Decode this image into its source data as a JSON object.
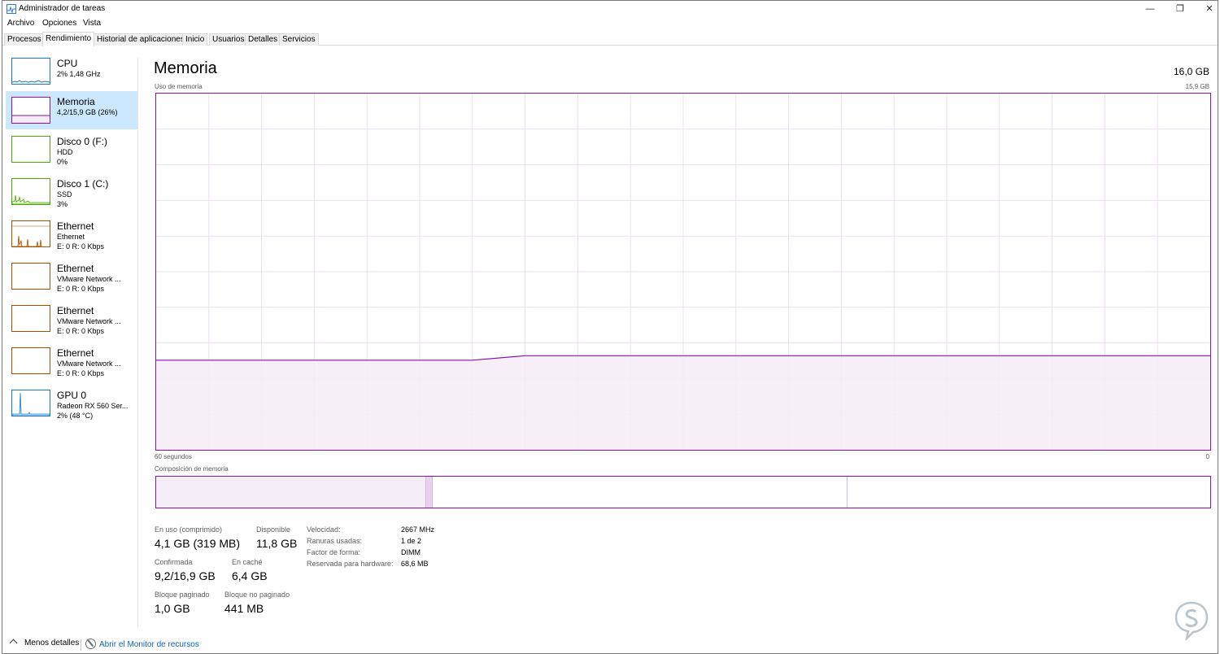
{
  "window": {
    "title": "Administrador de tareas",
    "minimize_glyph": "—",
    "maximize_glyph": "❐",
    "close_glyph": "✕"
  },
  "menu": [
    "Archivo",
    "Opciones",
    "Vista"
  ],
  "tabs": [
    {
      "label": "Procesos",
      "active": false
    },
    {
      "label": "Rendimiento",
      "active": true
    },
    {
      "label": "Historial de aplicaciones",
      "active": false
    },
    {
      "label": "Inicio",
      "active": false
    },
    {
      "label": "Usuarios",
      "active": false
    },
    {
      "label": "Detalles",
      "active": false
    },
    {
      "label": "Servicios",
      "active": false
    }
  ],
  "sidebar": {
    "items": [
      {
        "title": "CPU",
        "lines": [
          "2%  1,48 GHz"
        ],
        "color": "#1779c4",
        "selected": false
      },
      {
        "title": "Memoria",
        "lines": [
          "4,2/15,9 GB (26%)"
        ],
        "color": "#8b12ae",
        "selected": true
      },
      {
        "title": "Disco 0 (F:)",
        "lines": [
          "HDD",
          "0%"
        ],
        "color": "#4da60c",
        "selected": false
      },
      {
        "title": "Disco 1 (C:)",
        "lines": [
          "SSD",
          "3%"
        ],
        "color": "#4da60c",
        "selected": false
      },
      {
        "title": "Ethernet",
        "lines": [
          "Ethernet",
          "E: 0 R: 0 Kbps"
        ],
        "color": "#a74f01",
        "selected": false
      },
      {
        "title": "Ethernet",
        "lines": [
          "VMware Network ...",
          "E: 0 R: 0 Kbps"
        ],
        "color": "#a74f01",
        "selected": false
      },
      {
        "title": "Ethernet",
        "lines": [
          "VMware Network ...",
          "E: 0 R: 0 Kbps"
        ],
        "color": "#a74f01",
        "selected": false
      },
      {
        "title": "Ethernet",
        "lines": [
          "VMware Network ...",
          "E: 0 R: 0 Kbps"
        ],
        "color": "#a74f01",
        "selected": false
      },
      {
        "title": "GPU 0",
        "lines": [
          "Radeon RX 560 Ser...",
          "2% (48 °C)"
        ],
        "color": "#1779c4",
        "selected": false
      }
    ]
  },
  "main": {
    "title": "Memoria",
    "total": "16,0 GB",
    "usage_label": "Uso de memoria",
    "usage_max": "15,9 GB",
    "time_left": "60 segundos",
    "time_right": "0",
    "composition_label": "Composición de memoria"
  },
  "stats": {
    "in_use_label": "En uso (comprimido)",
    "in_use_value": "4,1 GB (319 MB)",
    "available_label": "Disponible",
    "available_value": "11,8 GB",
    "committed_label": "Confirmada",
    "committed_value": "9,2/16,9 GB",
    "cached_label": "En caché",
    "cached_value": "6,4 GB",
    "paged_label": "Bloque paginado",
    "paged_value": "1,0 GB",
    "nonpaged_label": "Bloque no paginado",
    "nonpaged_value": "441 MB",
    "speed_label": "Velocidad:",
    "speed_value": "2667 MHz",
    "slots_label": "Ranuras usadas:",
    "slots_value": "1 de 2",
    "form_label": "Factor de forma:",
    "form_value": "DIMM",
    "reserved_label": "Reservada para hardware:",
    "reserved_value": "68,6 MB"
  },
  "footer": {
    "less_details": "Menos detalles",
    "open_monitor": "Abrir el Monitor de recursos"
  },
  "chart_data": {
    "type": "area",
    "title": "Uso de memoria",
    "xlabel": "",
    "ylabel": "",
    "xlim": [
      60,
      0
    ],
    "ylim": [
      0,
      15.9
    ],
    "x": [
      60,
      52,
      47,
      42,
      39,
      36,
      33,
      30,
      24,
      18,
      12,
      6,
      0
    ],
    "series": [
      {
        "values": [
          4.0,
          4.0,
          4.0,
          4.0,
          4.2,
          4.2,
          4.2,
          4.2,
          4.2,
          4.2,
          4.2,
          4.2,
          4.2
        ]
      }
    ],
    "grid": true,
    "color": "#8b12ae",
    "fill": "#f4ecf7"
  },
  "composition_data": {
    "in_use_fraction": 0.256,
    "modified_fraction": 0.006,
    "standby_fraction": 0.394,
    "free_fraction": 0.344
  }
}
